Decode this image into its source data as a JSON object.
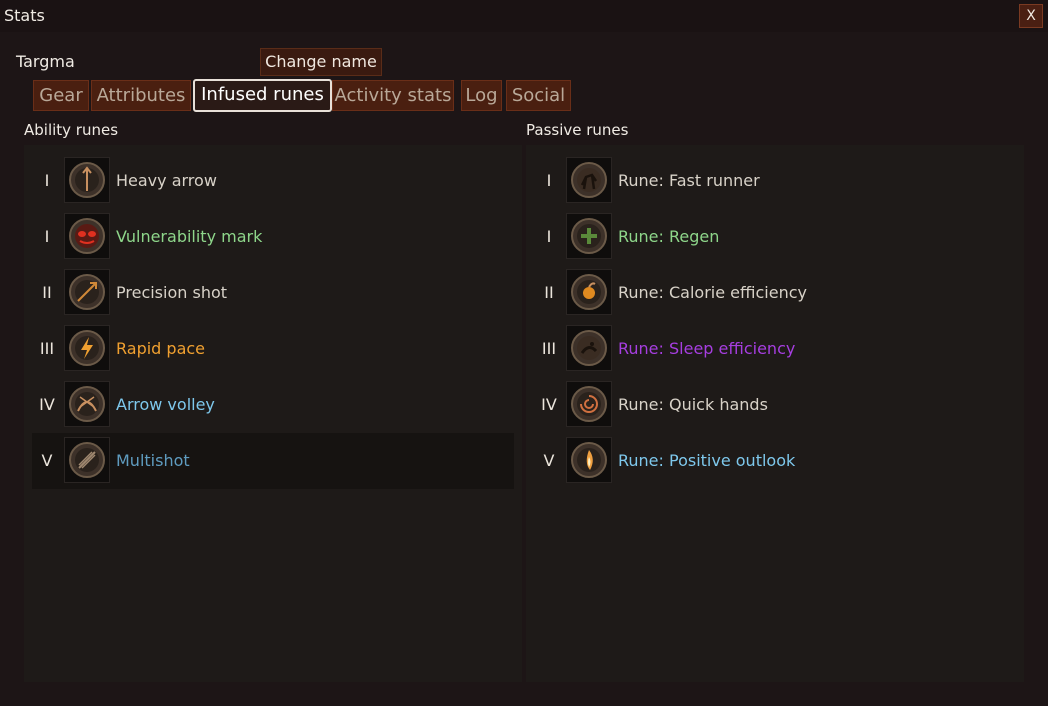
{
  "window": {
    "title": "Stats",
    "close_label": "X"
  },
  "character": {
    "name": "Targma",
    "change_name_label": "Change name"
  },
  "tabs": [
    {
      "label": "Gear",
      "active": false
    },
    {
      "label": "Attributes",
      "active": false
    },
    {
      "label": "Infused runes",
      "active": true
    },
    {
      "label": "Activity stats",
      "active": false
    },
    {
      "label": "Log",
      "active": false
    },
    {
      "label": "Social",
      "active": false
    }
  ],
  "ability_runes": {
    "title": "Ability runes",
    "items": [
      {
        "tier": "I",
        "name": "Heavy arrow",
        "color": "#d8d2c8",
        "icon": "heavy-arrow-icon"
      },
      {
        "tier": "I",
        "name": "Vulnerability mark",
        "color": "#8ed68a",
        "icon": "vulnerability-mark-icon"
      },
      {
        "tier": "II",
        "name": "Precision shot",
        "color": "#d8d2c8",
        "icon": "precision-shot-icon"
      },
      {
        "tier": "III",
        "name": "Rapid pace",
        "color": "#f0a030",
        "icon": "rapid-pace-icon"
      },
      {
        "tier": "IV",
        "name": "Arrow volley",
        "color": "#7ec8ec",
        "icon": "arrow-volley-icon"
      },
      {
        "tier": "V",
        "name": "Multishot",
        "color": "#5f9cc0",
        "icon": "multishot-icon"
      }
    ]
  },
  "passive_runes": {
    "title": "Passive runes",
    "items": [
      {
        "tier": "I",
        "name": "Rune: Fast runner",
        "color": "#d8d2c8",
        "icon": "fast-runner-icon"
      },
      {
        "tier": "I",
        "name": "Rune: Regen",
        "color": "#8ed68a",
        "icon": "regen-icon"
      },
      {
        "tier": "II",
        "name": "Rune: Calorie efficiency",
        "color": "#d8d2c8",
        "icon": "calorie-efficiency-icon"
      },
      {
        "tier": "III",
        "name": "Rune: Sleep efficiency",
        "color": "#a63ee0",
        "icon": "sleep-efficiency-icon"
      },
      {
        "tier": "IV",
        "name": "Rune: Quick hands",
        "color": "#d8d2c8",
        "icon": "quick-hands-icon"
      },
      {
        "tier": "V",
        "name": "Rune: Positive outlook",
        "color": "#7ec8ec",
        "icon": "positive-outlook-icon"
      }
    ]
  }
}
